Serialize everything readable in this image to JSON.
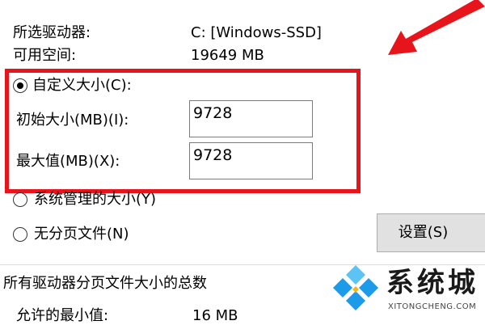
{
  "drive_info": {
    "selected_drive_label": "所选驱动器:",
    "selected_drive_value": "C:  [Windows-SSD]",
    "available_space_label": "可用空间:",
    "available_space_value": "19649 MB"
  },
  "paging_options": {
    "custom_size": {
      "label": "自定义大小(C):",
      "selected": true,
      "initial_size_label": "初始大小(MB)(I):",
      "initial_size_value": "9728",
      "maximum_size_label": "最大值(MB)(X):",
      "maximum_size_value": "9728"
    },
    "system_managed": {
      "label": "系统管理的大小(Y)",
      "selected": false
    },
    "no_paging_file": {
      "label": "无分页文件(N)",
      "selected": false
    },
    "set_button_label": "设置(S)"
  },
  "totals": {
    "section_title": "所有驱动器分页文件大小的总数",
    "minimum_allowed_label": "允许的最小值:",
    "minimum_allowed_value": "16 MB"
  },
  "watermark": {
    "text": "系统城",
    "url": "XITONGCHENG.COM"
  },
  "colors": {
    "highlight": "#e8141c",
    "arrow": "#e8141c",
    "button_bg": "#e1e1e1",
    "logo_blue": "#1e9be8",
    "logo_light_blue": "#5cc3f5"
  },
  "icons": {
    "arrow": "red-arrow-icon",
    "logo": "diamond-logo-icon"
  }
}
